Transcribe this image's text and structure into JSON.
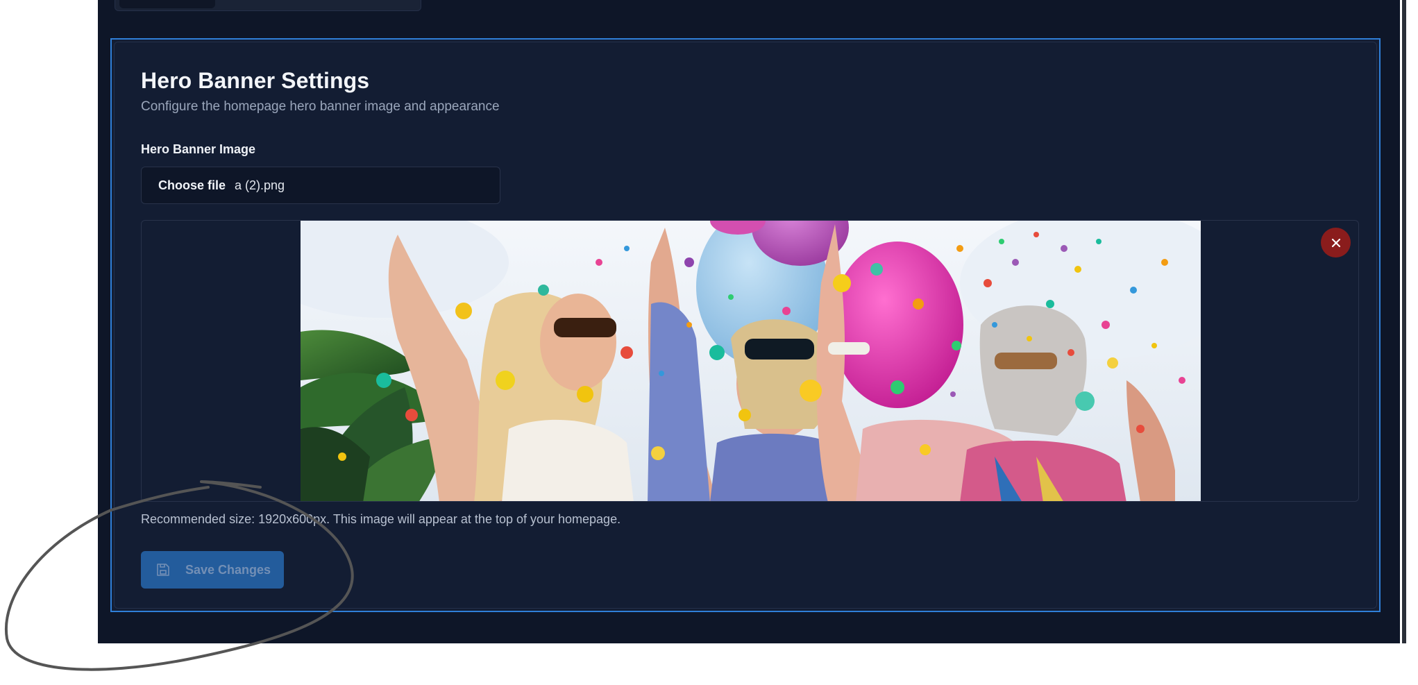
{
  "hero_settings": {
    "title": "Hero Banner Settings",
    "subtitle": "Configure the homepage hero banner image and appearance",
    "image_field": {
      "label": "Hero Banner Image",
      "choose_file_label": "Choose file",
      "selected_file": "a (2).png"
    },
    "preview": {
      "image_icon": "celebration-photo",
      "remove_icon": "close-icon"
    },
    "hint": "Recommended size: 1920x600px. This image will appear at the top of your homepage.",
    "save_button": {
      "label": "Save Changes",
      "icon": "floppy-disk-icon",
      "disabled": true
    }
  },
  "colors": {
    "page_background": "#0e1628",
    "card_background": "#131d33",
    "card_focus_border": "#2f7fd8",
    "primary_button": "#2563a8",
    "danger_button": "#8a1c1c",
    "annotation_stroke": "#555555"
  }
}
